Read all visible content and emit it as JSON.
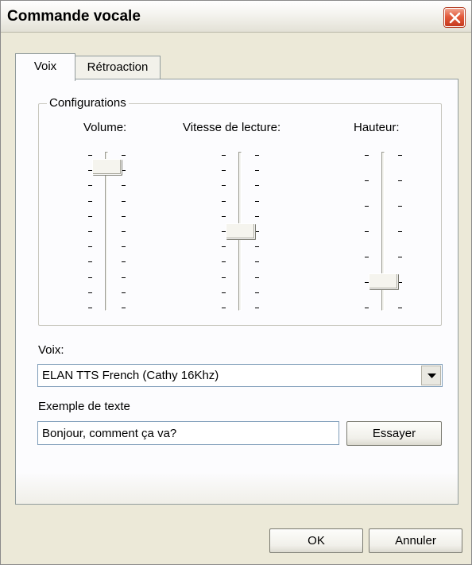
{
  "window": {
    "title": "Commande vocale"
  },
  "tabs": [
    {
      "label": "Voix",
      "active": true
    },
    {
      "label": "Rétroaction",
      "active": false
    }
  ],
  "configurations": {
    "group_label": "Configurations",
    "sliders": [
      {
        "label": "Volume:",
        "ticks": 11,
        "position_fraction": 0.95
      },
      {
        "label": "Vitesse de lecture:",
        "ticks": 11,
        "position_fraction": 0.5
      },
      {
        "label": "Hauteur:",
        "ticks": 7,
        "position_fraction": 0.15
      }
    ]
  },
  "voice": {
    "label": "Voix:",
    "selected": "ELAN TTS French (Cathy 16Khz)"
  },
  "example": {
    "label": "Exemple de texte",
    "value": "Bonjour, comment ça va?",
    "try_button": "Essayer"
  },
  "footer": {
    "ok_button": "OK",
    "cancel_button": "Annuler"
  },
  "icons": {
    "close": "close-icon",
    "dropdown": "chevron-down-icon"
  },
  "colors": {
    "close_button": "#e35a3b",
    "dialog_background": "#ece9d8",
    "tab_panel_background": "#fcfcfe"
  }
}
